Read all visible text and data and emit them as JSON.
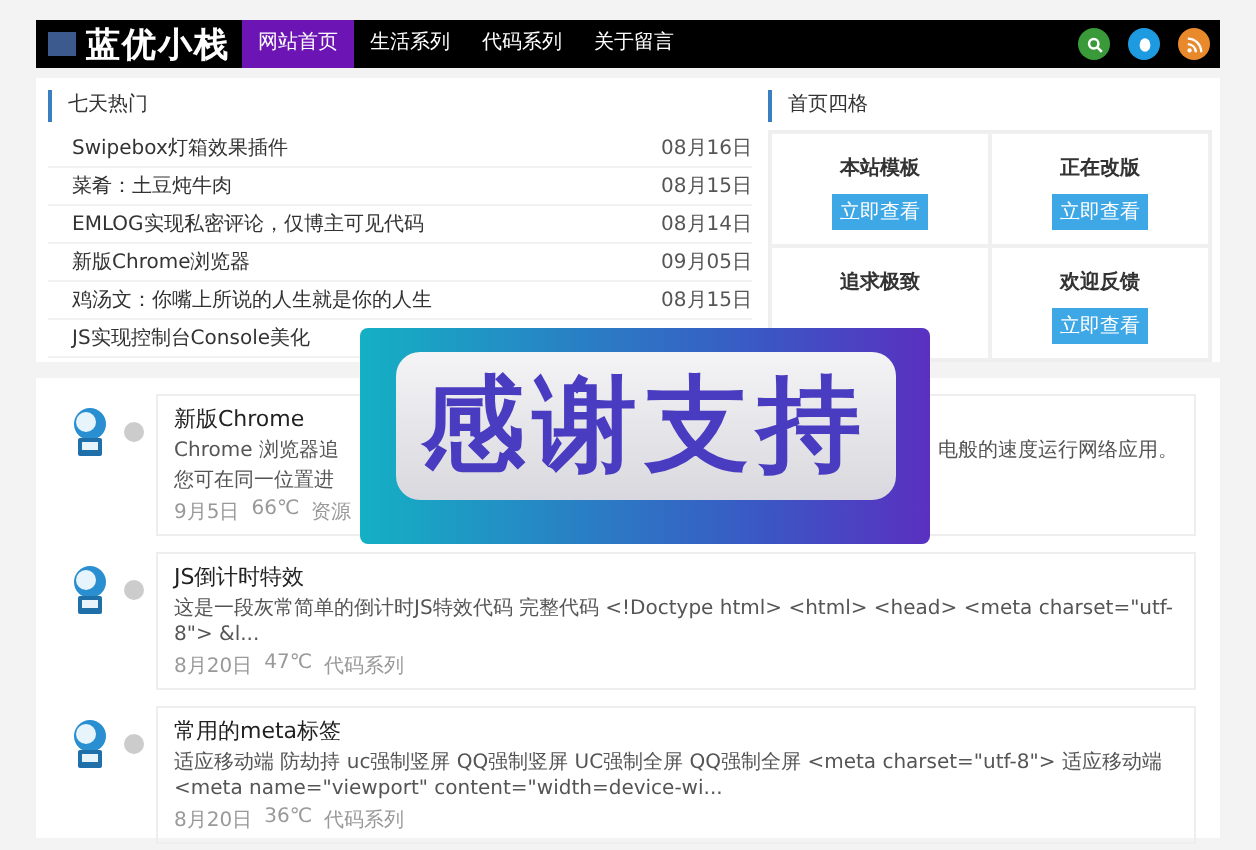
{
  "header": {
    "logo": "蓝优小栈",
    "nav": [
      {
        "label": "网站首页",
        "selected": true
      },
      {
        "label": "生活系列",
        "selected": false
      },
      {
        "label": "代码系列",
        "selected": false
      },
      {
        "label": "关于留言",
        "selected": false
      }
    ],
    "icons": [
      {
        "kind": "search",
        "color": "#3a9a3a"
      },
      {
        "kind": "qq",
        "color": "#1e9be0"
      },
      {
        "kind": "rss",
        "color": "#e8892b"
      }
    ]
  },
  "hot": {
    "title": "七天热门",
    "items": [
      {
        "title": "Swipebox灯箱效果插件",
        "date": "08月16日"
      },
      {
        "title": "菜肴：土豆炖牛肉",
        "date": "08月15日"
      },
      {
        "title": "EMLOG实现私密评论，仅博主可见代码",
        "date": "08月14日"
      },
      {
        "title": "新版Chrome浏览器",
        "date": "09月05日"
      },
      {
        "title": "鸡汤文：你嘴上所说的人生就是你的人生",
        "date": "08月15日"
      },
      {
        "title": "JS实现控制台Console美化"
      }
    ]
  },
  "grid": {
    "title": "首页四格",
    "cells": [
      {
        "label": "本站模板",
        "button": "立即查看"
      },
      {
        "label": "正在改版",
        "button": "立即查看"
      },
      {
        "label": "追求极致"
      },
      {
        "label": "欢迎反馈",
        "button": "立即查看"
      }
    ]
  },
  "posts": [
    {
      "title": "新版Chrome",
      "excerpt": "Chrome 浏览器追",
      "excerpt_end": "电般的速度运行网络应用。",
      "excerpt_line2": "您可在同一位置进",
      "meta": [
        "9月5日",
        "66℃",
        "资源"
      ]
    },
    {
      "title": "JS倒计时特效",
      "excerpt": "这是一段灰常简单的倒计时JS特效代码 完整代码 <!Doctype html> <html> <head> <meta charset=\"utf-8\"> &l...",
      "meta": [
        "8月20日",
        "47℃",
        "代码系列"
      ]
    },
    {
      "title": "常用的meta标签",
      "excerpt": "适应移动端 防劫持 uc强制竖屏 QQ强制竖屏 UC强制全屏 QQ强制全屏 <meta charset=\"utf-8\"> 适应移动端 <meta name=\"viewport\" content=\"width=device-wi...",
      "meta": [
        "8月20日",
        "36℃",
        "代码系列"
      ]
    }
  ],
  "overlay": {
    "text": "感谢支持"
  }
}
